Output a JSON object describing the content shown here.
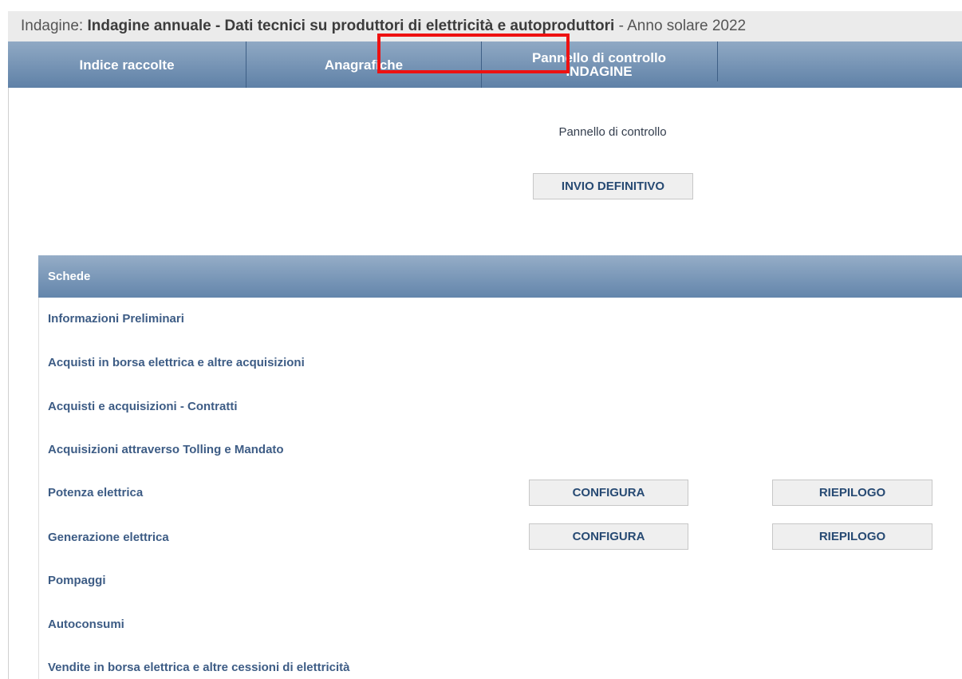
{
  "header": {
    "prefix": "Indagine: ",
    "title": "Indagine annuale - Dati tecnici su produttori di elettricità e autoproduttori",
    "suffix": " - Anno solare 2022"
  },
  "nav": {
    "tabs": [
      {
        "label": "Indice raccolte"
      },
      {
        "label": "Anagrafiche"
      },
      {
        "line1": "Pannello di controllo",
        "line2": "INDAGINE"
      }
    ]
  },
  "panel": {
    "label": "Pannello di controllo",
    "submit_label": "INVIO DEFINITIVO"
  },
  "schede": {
    "header": "Schede",
    "items": [
      {
        "label": "Informazioni Preliminari"
      },
      {
        "label": "Acquisti in borsa elettrica e altre acquisizioni"
      },
      {
        "label": "Acquisti e acquisizioni - Contratti"
      },
      {
        "label": "Acquisizioni attraverso Tolling e Mandato"
      },
      {
        "label": "Potenza elettrica",
        "configura": "CONFIGURA",
        "riepilogo": "RIEPILOGO"
      },
      {
        "label": "Generazione elettrica",
        "configura": "CONFIGURA",
        "riepilogo": "RIEPILOGO"
      },
      {
        "label": "Pompaggi"
      },
      {
        "label": "Autoconsumi"
      },
      {
        "label": "Vendite in borsa elettrica e altre cessioni di elettricità"
      }
    ]
  },
  "colors": {
    "nav_gradient_top": "#90a9c4",
    "nav_gradient_bottom": "#5f81a7",
    "link_text": "#3d5c85",
    "highlight": "#ee1111"
  }
}
